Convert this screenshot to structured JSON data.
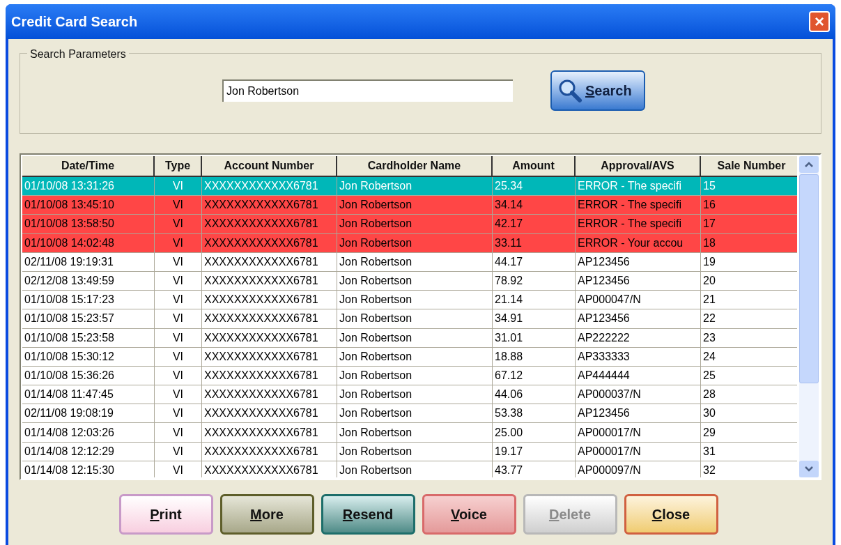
{
  "window": {
    "title": "Credit Card Search",
    "close_label": "×"
  },
  "search": {
    "group_label": "Search Parameters",
    "value": "Jon Robertson",
    "button": "Search"
  },
  "table": {
    "columns": [
      "Date/Time",
      "Type",
      "Account Number",
      "Cardholder Name",
      "Amount",
      "Approval/AVS",
      "Sale Number"
    ],
    "rows": [
      {
        "cells": [
          "01/10/08 13:31:26",
          "VI",
          "XXXXXXXXXXXX6781",
          "Jon Robertson",
          "25.34",
          "ERROR - The specifi",
          "15"
        ],
        "selected": true,
        "error": true
      },
      {
        "cells": [
          "01/10/08 13:45:10",
          "VI",
          "XXXXXXXXXXXX6781",
          "Jon Robertson",
          "34.14",
          "ERROR - The specifi",
          "16"
        ],
        "selected": false,
        "error": true
      },
      {
        "cells": [
          "01/10/08 13:58:50",
          "VI",
          "XXXXXXXXXXXX6781",
          "Jon Robertson",
          "42.17",
          "ERROR - The specifi",
          "17"
        ],
        "selected": false,
        "error": true
      },
      {
        "cells": [
          "01/10/08 14:02:48",
          "VI",
          "XXXXXXXXXXXX6781",
          "Jon Robertson",
          "33.11",
          "ERROR - Your accou",
          "18"
        ],
        "selected": false,
        "error": true
      },
      {
        "cells": [
          "02/11/08 19:19:31",
          "VI",
          "XXXXXXXXXXXX6781",
          "Jon Robertson",
          "44.17",
          "AP123456",
          "19"
        ],
        "selected": false,
        "error": false
      },
      {
        "cells": [
          "02/12/08 13:49:59",
          "VI",
          "XXXXXXXXXXXX6781",
          "Jon Robertson",
          "78.92",
          "AP123456",
          "20"
        ],
        "selected": false,
        "error": false
      },
      {
        "cells": [
          "01/10/08 15:17:23",
          "VI",
          "XXXXXXXXXXXX6781",
          "Jon Robertson",
          "21.14",
          "AP000047/N",
          "21"
        ],
        "selected": false,
        "error": false
      },
      {
        "cells": [
          "01/10/08 15:23:57",
          "VI",
          "XXXXXXXXXXXX6781",
          "Jon Robertson",
          "34.91",
          "AP123456",
          "22"
        ],
        "selected": false,
        "error": false
      },
      {
        "cells": [
          "01/10/08 15:23:58",
          "VI",
          "XXXXXXXXXXXX6781",
          "Jon Robertson",
          "31.01",
          "AP222222",
          "23"
        ],
        "selected": false,
        "error": false
      },
      {
        "cells": [
          "01/10/08 15:30:12",
          "VI",
          "XXXXXXXXXXXX6781",
          "Jon Robertson",
          "18.88",
          "AP333333",
          "24"
        ],
        "selected": false,
        "error": false
      },
      {
        "cells": [
          "01/10/08 15:36:26",
          "VI",
          "XXXXXXXXXXXX6781",
          "Jon Robertson",
          "67.12",
          "AP444444",
          "25"
        ],
        "selected": false,
        "error": false
      },
      {
        "cells": [
          "01/14/08 11:47:45",
          "VI",
          "XXXXXXXXXXXX6781",
          "Jon Robertson",
          "44.06",
          "AP000037/N",
          "28"
        ],
        "selected": false,
        "error": false
      },
      {
        "cells": [
          "02/11/08 19:08:19",
          "VI",
          "XXXXXXXXXXXX6781",
          "Jon Robertson",
          "53.38",
          "AP123456",
          "30"
        ],
        "selected": false,
        "error": false
      },
      {
        "cells": [
          "01/14/08 12:03:26",
          "VI",
          "XXXXXXXXXXXX6781",
          "Jon Robertson",
          "25.00",
          "AP000017/N",
          "29"
        ],
        "selected": false,
        "error": false
      },
      {
        "cells": [
          "01/14/08 12:12:29",
          "VI",
          "XXXXXXXXXXXX6781",
          "Jon Robertson",
          "19.17",
          "AP000017/N",
          "31"
        ],
        "selected": false,
        "error": false
      },
      {
        "cells": [
          "01/14/08 12:15:30",
          "VI",
          "XXXXXXXXXXXX6781",
          "Jon Robertson",
          "43.77",
          "AP000097/N",
          "32"
        ],
        "selected": false,
        "error": false
      }
    ]
  },
  "buttons": [
    {
      "label": "Print",
      "kind": "print",
      "disabled": false
    },
    {
      "label": "More",
      "kind": "more",
      "disabled": false
    },
    {
      "label": "Resend",
      "kind": "resend",
      "disabled": false
    },
    {
      "label": "Voice",
      "kind": "voice",
      "disabled": false
    },
    {
      "label": "Delete",
      "kind": "delete",
      "disabled": true
    },
    {
      "label": "Close",
      "kind": "close",
      "disabled": false
    }
  ]
}
